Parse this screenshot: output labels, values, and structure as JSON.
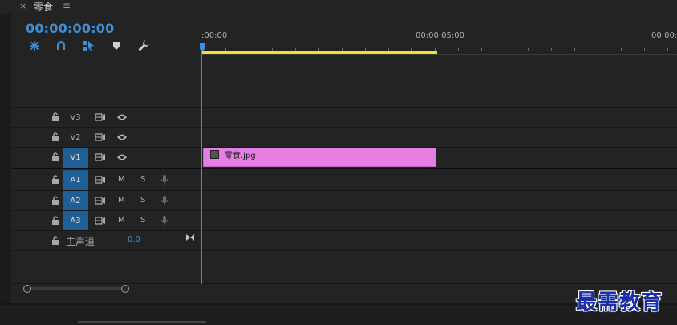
{
  "tab": {
    "close_glyph": "×",
    "title": "零食",
    "menu_glyph": "≡"
  },
  "timecode": "00:00:00:00",
  "toolbar": {
    "tools": [
      {
        "name": "insert-sequence-nest-icon"
      },
      {
        "name": "snap-magnet-icon"
      },
      {
        "name": "linked-selection-icon"
      },
      {
        "name": "add-marker-icon"
      },
      {
        "name": "wrench-settings-icon"
      }
    ]
  },
  "ruler": {
    "labels": [
      ":00:00",
      "00:00:05:00",
      "00:00:1"
    ]
  },
  "tracks": {
    "video": [
      {
        "label": "V3",
        "targeted": false
      },
      {
        "label": "V2",
        "targeted": false
      },
      {
        "label": "V1",
        "targeted": true
      }
    ],
    "audio": [
      {
        "label": "A1",
        "mute": "M",
        "solo": "S"
      },
      {
        "label": "A2",
        "mute": "M",
        "solo": "S"
      },
      {
        "label": "A3",
        "mute": "M",
        "solo": "S"
      }
    ],
    "master": {
      "label": "主声道",
      "value": "0.0"
    }
  },
  "clip": {
    "name": "零食.jpg",
    "color": "#e57fe4"
  },
  "colors": {
    "accent": "#3d8fd6",
    "work_area": "#f0e22c",
    "target": "#1f5f93"
  },
  "watermark": "最需教育"
}
